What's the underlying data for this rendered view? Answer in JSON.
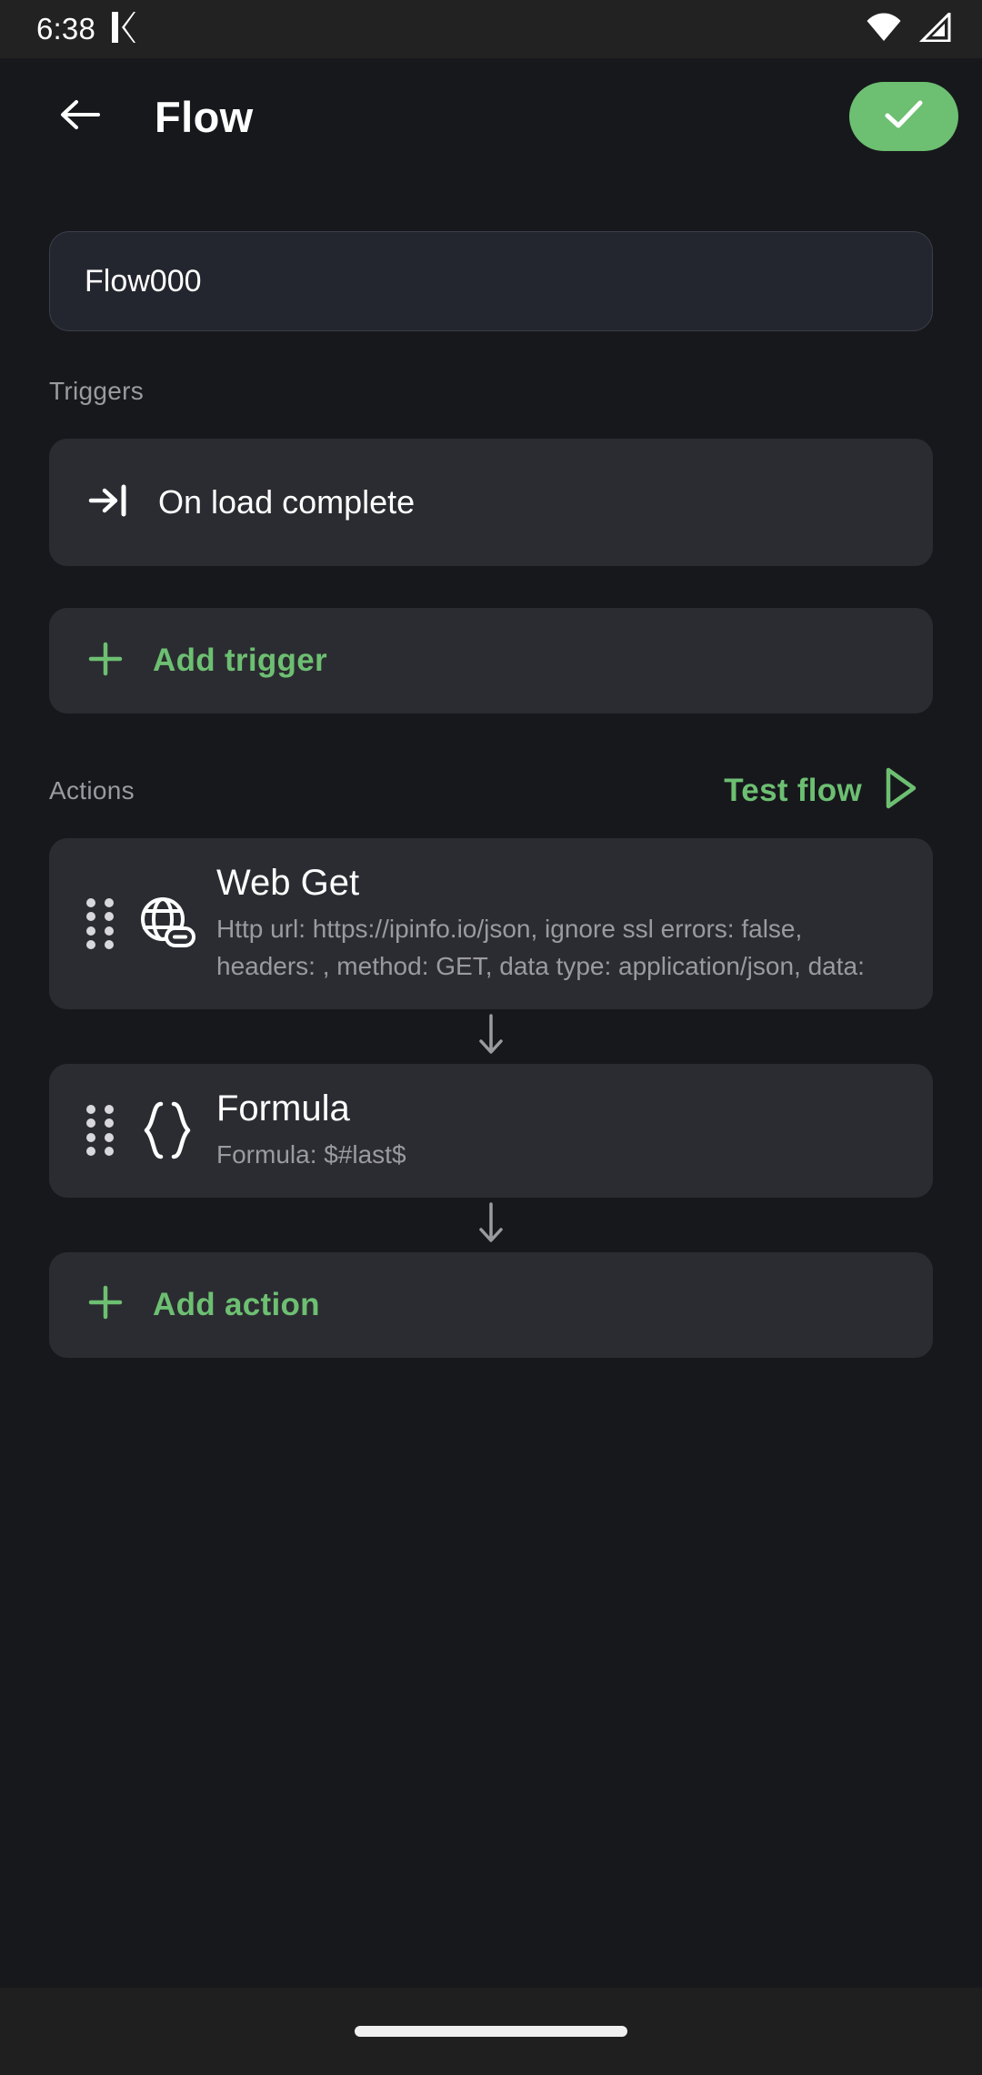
{
  "status_bar": {
    "time": "6:38",
    "app_glyph_icon": "k-app-icon",
    "wifi_icon": "wifi-icon",
    "signal_icon": "cellular-signal-icon"
  },
  "app_bar": {
    "back_icon": "back-arrow-icon",
    "title": "Flow",
    "save_icon": "check-icon"
  },
  "flow_name": {
    "value": "Flow000",
    "placeholder": "Flow name"
  },
  "triggers": {
    "label": "Triggers",
    "items": [
      {
        "icon": "arrow-to-bar-icon",
        "label": "On load complete"
      }
    ],
    "add_label": "Add trigger",
    "add_icon": "plus-icon"
  },
  "actions": {
    "label": "Actions",
    "test_flow_label": "Test flow",
    "test_flow_icon": "play-icon",
    "items": [
      {
        "icon": "globe-link-icon",
        "title": "Web Get",
        "subtitle": "Http url: https://ipinfo.io/json, ignore ssl errors: false, headers: , method: GET, data type: application/json, data:",
        "drag_icon": "drag-handle-icon"
      },
      {
        "icon": "curly-braces-icon",
        "title": "Formula",
        "subtitle": "Formula: $#last$",
        "drag_icon": "drag-handle-icon"
      }
    ],
    "connector_icon": "arrow-down-icon",
    "add_label": "Add action",
    "add_icon": "plus-icon"
  },
  "nav_bar": {
    "home_pill": "gesture-home-pill"
  },
  "colors": {
    "accent_green": "#6dbf72",
    "page_background": "#17181c",
    "card_background": "#2b2c31",
    "input_background": "#24262f",
    "muted_text": "#9a9a9f"
  }
}
